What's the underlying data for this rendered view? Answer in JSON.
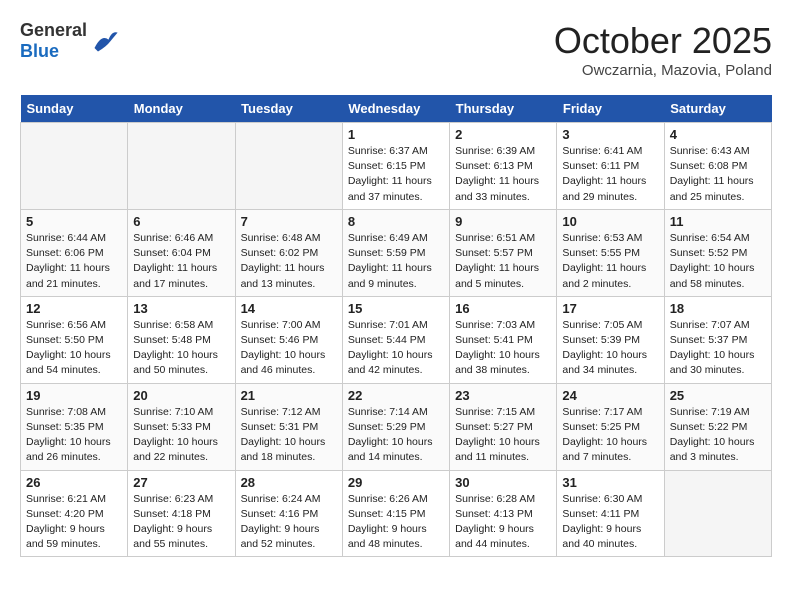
{
  "header": {
    "logo": {
      "general": "General",
      "blue": "Blue"
    },
    "title": "October 2025",
    "subtitle": "Owczarnia, Mazovia, Poland"
  },
  "days_of_week": [
    "Sunday",
    "Monday",
    "Tuesday",
    "Wednesday",
    "Thursday",
    "Friday",
    "Saturday"
  ],
  "weeks": [
    [
      {
        "day": "",
        "info": "",
        "empty": true
      },
      {
        "day": "",
        "info": "",
        "empty": true
      },
      {
        "day": "",
        "info": "",
        "empty": true
      },
      {
        "day": "1",
        "info": "Sunrise: 6:37 AM\nSunset: 6:15 PM\nDaylight: 11 hours\nand 37 minutes."
      },
      {
        "day": "2",
        "info": "Sunrise: 6:39 AM\nSunset: 6:13 PM\nDaylight: 11 hours\nand 33 minutes."
      },
      {
        "day": "3",
        "info": "Sunrise: 6:41 AM\nSunset: 6:11 PM\nDaylight: 11 hours\nand 29 minutes."
      },
      {
        "day": "4",
        "info": "Sunrise: 6:43 AM\nSunset: 6:08 PM\nDaylight: 11 hours\nand 25 minutes."
      }
    ],
    [
      {
        "day": "5",
        "info": "Sunrise: 6:44 AM\nSunset: 6:06 PM\nDaylight: 11 hours\nand 21 minutes."
      },
      {
        "day": "6",
        "info": "Sunrise: 6:46 AM\nSunset: 6:04 PM\nDaylight: 11 hours\nand 17 minutes."
      },
      {
        "day": "7",
        "info": "Sunrise: 6:48 AM\nSunset: 6:02 PM\nDaylight: 11 hours\nand 13 minutes."
      },
      {
        "day": "8",
        "info": "Sunrise: 6:49 AM\nSunset: 5:59 PM\nDaylight: 11 hours\nand 9 minutes."
      },
      {
        "day": "9",
        "info": "Sunrise: 6:51 AM\nSunset: 5:57 PM\nDaylight: 11 hours\nand 5 minutes."
      },
      {
        "day": "10",
        "info": "Sunrise: 6:53 AM\nSunset: 5:55 PM\nDaylight: 11 hours\nand 2 minutes."
      },
      {
        "day": "11",
        "info": "Sunrise: 6:54 AM\nSunset: 5:52 PM\nDaylight: 10 hours\nand 58 minutes."
      }
    ],
    [
      {
        "day": "12",
        "info": "Sunrise: 6:56 AM\nSunset: 5:50 PM\nDaylight: 10 hours\nand 54 minutes."
      },
      {
        "day": "13",
        "info": "Sunrise: 6:58 AM\nSunset: 5:48 PM\nDaylight: 10 hours\nand 50 minutes."
      },
      {
        "day": "14",
        "info": "Sunrise: 7:00 AM\nSunset: 5:46 PM\nDaylight: 10 hours\nand 46 minutes."
      },
      {
        "day": "15",
        "info": "Sunrise: 7:01 AM\nSunset: 5:44 PM\nDaylight: 10 hours\nand 42 minutes."
      },
      {
        "day": "16",
        "info": "Sunrise: 7:03 AM\nSunset: 5:41 PM\nDaylight: 10 hours\nand 38 minutes."
      },
      {
        "day": "17",
        "info": "Sunrise: 7:05 AM\nSunset: 5:39 PM\nDaylight: 10 hours\nand 34 minutes."
      },
      {
        "day": "18",
        "info": "Sunrise: 7:07 AM\nSunset: 5:37 PM\nDaylight: 10 hours\nand 30 minutes."
      }
    ],
    [
      {
        "day": "19",
        "info": "Sunrise: 7:08 AM\nSunset: 5:35 PM\nDaylight: 10 hours\nand 26 minutes."
      },
      {
        "day": "20",
        "info": "Sunrise: 7:10 AM\nSunset: 5:33 PM\nDaylight: 10 hours\nand 22 minutes."
      },
      {
        "day": "21",
        "info": "Sunrise: 7:12 AM\nSunset: 5:31 PM\nDaylight: 10 hours\nand 18 minutes."
      },
      {
        "day": "22",
        "info": "Sunrise: 7:14 AM\nSunset: 5:29 PM\nDaylight: 10 hours\nand 14 minutes."
      },
      {
        "day": "23",
        "info": "Sunrise: 7:15 AM\nSunset: 5:27 PM\nDaylight: 10 hours\nand 11 minutes."
      },
      {
        "day": "24",
        "info": "Sunrise: 7:17 AM\nSunset: 5:25 PM\nDaylight: 10 hours\nand 7 minutes."
      },
      {
        "day": "25",
        "info": "Sunrise: 7:19 AM\nSunset: 5:22 PM\nDaylight: 10 hours\nand 3 minutes."
      }
    ],
    [
      {
        "day": "26",
        "info": "Sunrise: 6:21 AM\nSunset: 4:20 PM\nDaylight: 9 hours\nand 59 minutes."
      },
      {
        "day": "27",
        "info": "Sunrise: 6:23 AM\nSunset: 4:18 PM\nDaylight: 9 hours\nand 55 minutes."
      },
      {
        "day": "28",
        "info": "Sunrise: 6:24 AM\nSunset: 4:16 PM\nDaylight: 9 hours\nand 52 minutes."
      },
      {
        "day": "29",
        "info": "Sunrise: 6:26 AM\nSunset: 4:15 PM\nDaylight: 9 hours\nand 48 minutes."
      },
      {
        "day": "30",
        "info": "Sunrise: 6:28 AM\nSunset: 4:13 PM\nDaylight: 9 hours\nand 44 minutes."
      },
      {
        "day": "31",
        "info": "Sunrise: 6:30 AM\nSunset: 4:11 PM\nDaylight: 9 hours\nand 40 minutes."
      },
      {
        "day": "",
        "info": "",
        "empty": true
      }
    ]
  ]
}
